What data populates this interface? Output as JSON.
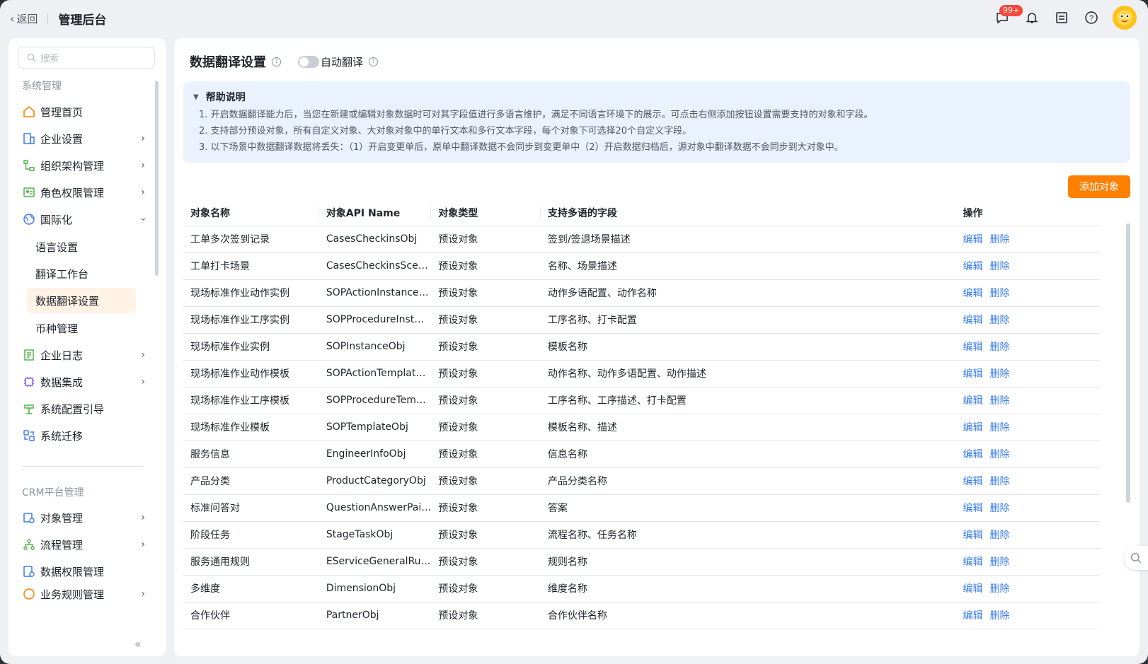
{
  "topbar": {
    "back_label": "返回",
    "title": "管理后台",
    "badge": "99+"
  },
  "sidebar": {
    "search_placeholder": "搜索",
    "group1": "系统管理",
    "items1": [
      {
        "label": "管理首页",
        "icon": "home-icon"
      },
      {
        "label": "企业设置",
        "icon": "company-icon"
      },
      {
        "label": "组织架构管理",
        "icon": "org-icon"
      },
      {
        "label": "角色权限管理",
        "icon": "role-icon"
      },
      {
        "label": "国际化",
        "icon": "globe-icon"
      }
    ],
    "sub_items": [
      "语言设置",
      "翻译工作台",
      "数据翻译设置",
      "币种管理"
    ],
    "items2": [
      {
        "label": "企业日志",
        "icon": "log-icon"
      },
      {
        "label": "数据集成",
        "icon": "chip-icon"
      },
      {
        "label": "系统配置引导",
        "icon": "signpost-icon"
      },
      {
        "label": "系统迁移",
        "icon": "migrate-icon"
      }
    ],
    "group2": "CRM平台管理",
    "items3": [
      {
        "label": "对象管理",
        "icon": "object-icon"
      },
      {
        "label": "流程管理",
        "icon": "flow-icon"
      },
      {
        "label": "数据权限管理",
        "icon": "data-permission-icon"
      },
      {
        "label": "业务规则管理",
        "icon": "rule-icon"
      }
    ]
  },
  "main": {
    "title": "数据翻译设置",
    "toggle_label": "自动翻译",
    "help_title": "帮助说明",
    "help_lines": [
      "1. 开启数据翻译能力后，当您在新建或编辑对象数据时可对其字段值进行多语言维护，满足不同语言环境下的展示。可点击右侧添加按钮设置需要支持的对象和字段。",
      "2. 支持部分预设对象，所有自定义对象、大对象对象中的单行文本和多行文本字段，每个对象下可选择20个自定义字段。",
      "3. 以下场景中数据翻译数据将丢失：（1）开启变更单后，原单中翻译数据不会同步到变更单中（2）开启数据归档后，源对象中翻译数据不会同步到大对象中。"
    ],
    "add_button": "添加对象",
    "columns": [
      "对象名称",
      "对象API Name",
      "对象类型",
      "支持多语的字段",
      "操作"
    ],
    "edit_label": "编辑",
    "delete_label": "删除",
    "rows": [
      [
        "工单多次签到记录",
        "CasesCheckinsObj",
        "预设对象",
        "签到/签退场景描述"
      ],
      [
        "工单打卡场景",
        "CasesCheckinsSce…",
        "预设对象",
        "名称、场景描述"
      ],
      [
        "现场标准作业动作实例",
        "SOPActionInstance…",
        "预设对象",
        "动作多语配置、动作名称"
      ],
      [
        "现场标准作业工序实例",
        "SOPProcedureInst…",
        "预设对象",
        "工序名称、打卡配置"
      ],
      [
        "现场标准作业实例",
        "SOPInstanceObj",
        "预设对象",
        "模板名称"
      ],
      [
        "现场标准作业动作模板",
        "SOPActionTemplat…",
        "预设对象",
        "动作名称、动作多语配置、动作描述"
      ],
      [
        "现场标准作业工序模板",
        "SOPProcedureTem…",
        "预设对象",
        "工序名称、工序描述、打卡配置"
      ],
      [
        "现场标准作业模板",
        "SOPTemplateObj",
        "预设对象",
        "模板名称、描述"
      ],
      [
        "服务信息",
        "EngineerInfoObj",
        "预设对象",
        "信息名称"
      ],
      [
        "产品分类",
        "ProductCategoryObj",
        "预设对象",
        "产品分类名称"
      ],
      [
        "标准问答对",
        "QuestionAnswerPai…",
        "预设对象",
        "答案"
      ],
      [
        "阶段任务",
        "StageTaskObj",
        "预设对象",
        "流程名称、任务名称"
      ],
      [
        "服务通用规则",
        "EServiceGeneralRu…",
        "预设对象",
        "规则名称"
      ],
      [
        "多维度",
        "DimensionObj",
        "预设对象",
        "维度名称"
      ],
      [
        "合作伙伴",
        "PartnerObj",
        "预设对象",
        "合作伙伴名称"
      ]
    ]
  }
}
